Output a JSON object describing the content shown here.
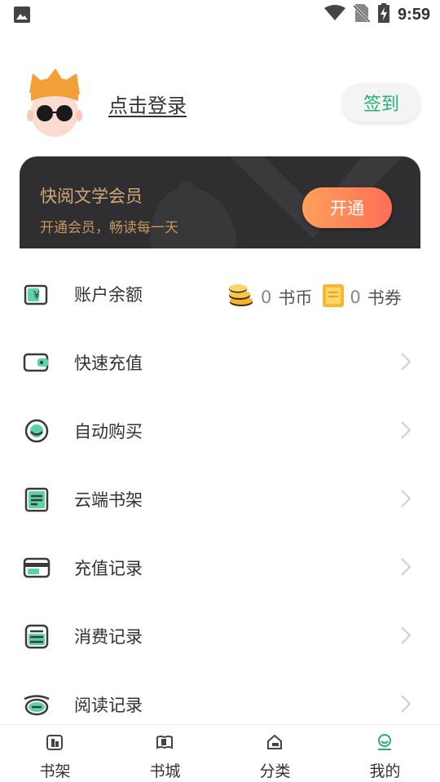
{
  "status_bar": {
    "time": "9:59"
  },
  "profile": {
    "login_label": "点击登录",
    "checkin_label": "签到"
  },
  "vip": {
    "title": "快阅文学会员",
    "subtitle": "开通会员，畅读每一天",
    "button_label": "开通"
  },
  "menu": {
    "account": {
      "label": "账户余额",
      "coins_value": "0",
      "coins_unit": "书币",
      "coupons_value": "0",
      "coupons_unit": "书券"
    },
    "items": [
      {
        "label": "快速充值",
        "icon": "wallet-icon"
      },
      {
        "label": "自动购买",
        "icon": "auto-buy-icon"
      },
      {
        "label": "云端书架",
        "icon": "cloud-shelf-icon"
      },
      {
        "label": "充值记录",
        "icon": "card-icon"
      },
      {
        "label": "消费记录",
        "icon": "receipt-icon"
      },
      {
        "label": "阅读记录",
        "icon": "eye-icon"
      }
    ]
  },
  "bottom_nav": {
    "items": [
      {
        "label": "书架",
        "icon": "bookshelf-icon",
        "active": false
      },
      {
        "label": "书城",
        "icon": "bookstore-icon",
        "active": false
      },
      {
        "label": "分类",
        "icon": "category-icon",
        "active": false
      },
      {
        "label": "我的",
        "icon": "profile-icon",
        "active": true
      }
    ]
  },
  "colors": {
    "accent": "#27b07a",
    "vip_bg": "#2f2f32",
    "vip_gold": "#d2a778",
    "vip_button": "#ff7a58",
    "icon_green": "#5bd3a4",
    "icon_gray": "#3a3a3a"
  }
}
